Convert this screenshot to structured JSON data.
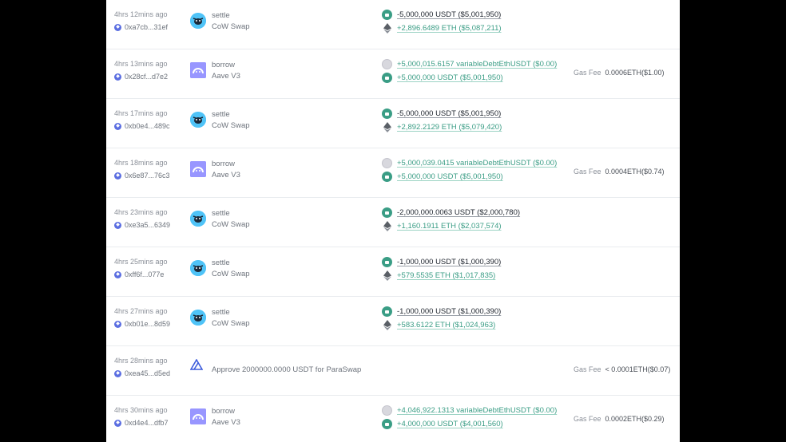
{
  "colors": {
    "positive": "#3a9d85",
    "negative": "#222831",
    "muted": "#8a8f98",
    "usdt": "#3a9d85",
    "cow": "#4fc3f7",
    "aave": "#9896ff",
    "paraswap": "#3e5ddc"
  },
  "gas_label": "Gas Fee",
  "rows": [
    {
      "time": "4hrs 12mins ago",
      "hash": "0xa7cb...31ef",
      "icon": "cow-icon",
      "action": "settle",
      "protocol": "CoW Swap",
      "transfers": [
        {
          "token": "usdt-icon",
          "sign": "neg",
          "text": "-5,000,000 USDT ($5,001,950)"
        },
        {
          "token": "eth-icon",
          "sign": "pos",
          "text": "+2,896.6489 ETH ($5,087,211)"
        }
      ],
      "gas": ""
    },
    {
      "time": "4hrs 13mins ago",
      "hash": "0x28cf...d7e2",
      "icon": "aave-icon",
      "action": "borrow",
      "protocol": "Aave V3",
      "transfers": [
        {
          "token": "debt-icon",
          "sign": "pos",
          "text": "+5,000,015.6157 variableDebtEthUSDT ($0.00)"
        },
        {
          "token": "usdt-icon",
          "sign": "pos",
          "text": "+5,000,000 USDT ($5,001,950)"
        }
      ],
      "gas": "0.0006ETH($1.00)"
    },
    {
      "time": "4hrs 17mins ago",
      "hash": "0xb0e4...489c",
      "icon": "cow-icon",
      "action": "settle",
      "protocol": "CoW Swap",
      "transfers": [
        {
          "token": "usdt-icon",
          "sign": "neg",
          "text": "-5,000,000 USDT ($5,001,950)"
        },
        {
          "token": "eth-icon",
          "sign": "pos",
          "text": "+2,892.2129 ETH ($5,079,420)"
        }
      ],
      "gas": ""
    },
    {
      "time": "4hrs 18mins ago",
      "hash": "0x6e87...76c3",
      "icon": "aave-icon",
      "action": "borrow",
      "protocol": "Aave V3",
      "transfers": [
        {
          "token": "debt-icon",
          "sign": "pos",
          "text": "+5,000,039.0415 variableDebtEthUSDT ($0.00)"
        },
        {
          "token": "usdt-icon",
          "sign": "pos",
          "text": "+5,000,000 USDT ($5,001,950)"
        }
      ],
      "gas": "0.0004ETH($0.74)"
    },
    {
      "time": "4hrs 23mins ago",
      "hash": "0xe3a5...6349",
      "icon": "cow-icon",
      "action": "settle",
      "protocol": "CoW Swap",
      "transfers": [
        {
          "token": "usdt-icon",
          "sign": "neg",
          "text": "-2,000,000.0063 USDT ($2,000,780)"
        },
        {
          "token": "eth-icon",
          "sign": "pos",
          "text": "+1,160.1911 ETH ($2,037,574)"
        }
      ],
      "gas": ""
    },
    {
      "time": "4hrs 25mins ago",
      "hash": "0xff6f...077e",
      "icon": "cow-icon",
      "action": "settle",
      "protocol": "CoW Swap",
      "transfers": [
        {
          "token": "usdt-icon",
          "sign": "neg",
          "text": "-1,000,000 USDT ($1,000,390)"
        },
        {
          "token": "eth-icon",
          "sign": "pos",
          "text": "+579.5535 ETH ($1,017,835)"
        }
      ],
      "gas": ""
    },
    {
      "time": "4hrs 27mins ago",
      "hash": "0xb01e...8d59",
      "icon": "cow-icon",
      "action": "settle",
      "protocol": "CoW Swap",
      "transfers": [
        {
          "token": "usdt-icon",
          "sign": "neg",
          "text": "-1,000,000 USDT ($1,000,390)"
        },
        {
          "token": "eth-icon",
          "sign": "pos",
          "text": "+583.6122 ETH ($1,024,963)"
        }
      ],
      "gas": ""
    },
    {
      "time": "4hrs 28mins ago",
      "hash": "0xea45...d5ed",
      "icon": "paraswap-icon",
      "action": "Approve 2000000.0000 USDT for ParaSwap",
      "protocol": "",
      "transfers": [],
      "gas": "< 0.0001ETH($0.07)"
    },
    {
      "time": "4hrs 30mins ago",
      "hash": "0xd4e4...dfb7",
      "icon": "aave-icon",
      "action": "borrow",
      "protocol": "Aave V3",
      "transfers": [
        {
          "token": "debt-icon",
          "sign": "pos",
          "text": "+4,046,922.1313 variableDebtEthUSDT ($0.00)"
        },
        {
          "token": "usdt-icon",
          "sign": "pos",
          "text": "+4,000,000 USDT ($4,001,560)"
        }
      ],
      "gas": "0.0002ETH($0.29)"
    }
  ]
}
